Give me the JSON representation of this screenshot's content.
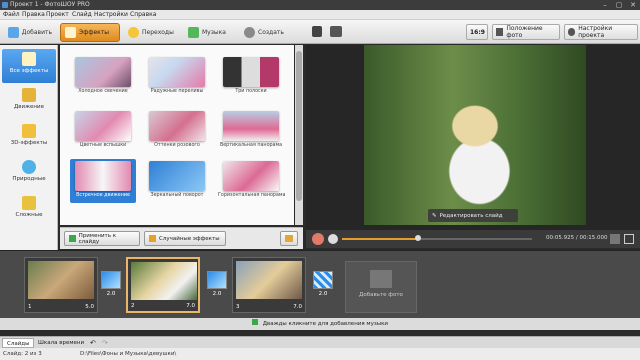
{
  "window": {
    "title": "Проект 1 - ФотоШОУ PRO"
  },
  "menu": [
    "Файл",
    "Правка",
    "Проект",
    "Слайд",
    "Настройки",
    "Справка"
  ],
  "toolbar": {
    "tabs": [
      "Добавить",
      "Эффекты",
      "Переходы",
      "Музыка",
      "Создать"
    ],
    "aspect": "16:9",
    "photo_position": "Положение фото",
    "project_settings": "Настройки проекта"
  },
  "sidebar": {
    "items": [
      "Все эффекты",
      "Движение",
      "3D-эффекты",
      "Природные",
      "Сложные"
    ]
  },
  "effects": [
    {
      "label": "Холодное свечение"
    },
    {
      "label": "Радужные переливы"
    },
    {
      "label": "Три полоски"
    },
    {
      "label": "Цветные вспышки"
    },
    {
      "label": "Оттенки розового"
    },
    {
      "label": "Вертикальная панорама"
    },
    {
      "label": "Встречное движение"
    },
    {
      "label": "Зеркальный поворот"
    },
    {
      "label": "Горизонтальная панорама"
    }
  ],
  "actions": {
    "apply": "Применить к слайду",
    "random": "Случайные эффекты"
  },
  "preview": {
    "edit_slide": "Редактировать слайд",
    "time": "00:05.925 / 00:15.000",
    "progress": 0.4
  },
  "timeline": {
    "slides": [
      {
        "num": "1",
        "dur": "5.0"
      },
      {
        "num": "2",
        "dur": "7.0"
      },
      {
        "num": "3",
        "dur": "7.0"
      }
    ],
    "transitions": [
      "2.0",
      "2.0",
      "2.0"
    ],
    "add_photo": "Добавьте фото",
    "music_hint": "Дважды кликните для добавления музыки"
  },
  "bottom_tabs": [
    "Слайды",
    "Шкала времени"
  ],
  "status": {
    "slide": "Слайд: 2 из 3",
    "path": "D:\\Files\\Фоны и Музыка\\девушки\\"
  },
  "colors": {
    "accent": "#e08a1c",
    "selected": "#2f7fd6"
  }
}
